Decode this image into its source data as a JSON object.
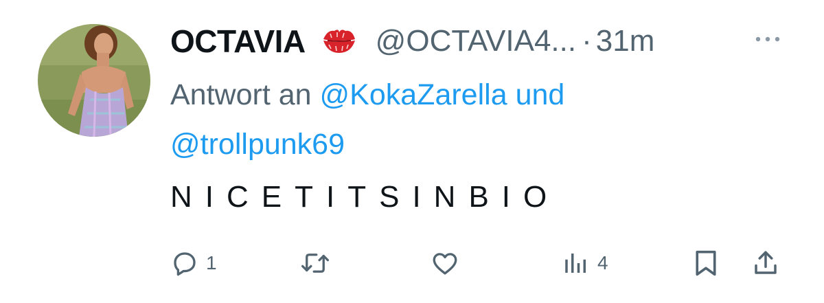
{
  "tweet": {
    "display_name": "OCTAVIA",
    "emoji": "kiss-mark-icon",
    "handle": "@OCTAVIA4...",
    "separator": "·",
    "time": "31m",
    "reply_prefix": "Antwort an",
    "reply_mention_1": "@KokaZarella",
    "reply_conjunction": "und",
    "reply_mention_2": "@trollpunk69",
    "text": "NICETITSINBIO"
  },
  "actions": {
    "reply_count": "1",
    "retweet_count": "",
    "like_count": "",
    "views_count": "4"
  },
  "colors": {
    "text": "#0f1419",
    "secondary": "#536471",
    "link": "#1d9bf0",
    "emoji": "#d8232a"
  },
  "icons": [
    "kiss-mark-icon",
    "more-icon",
    "reply-icon",
    "retweet-icon",
    "like-icon",
    "views-icon",
    "bookmark-icon",
    "share-icon"
  ]
}
